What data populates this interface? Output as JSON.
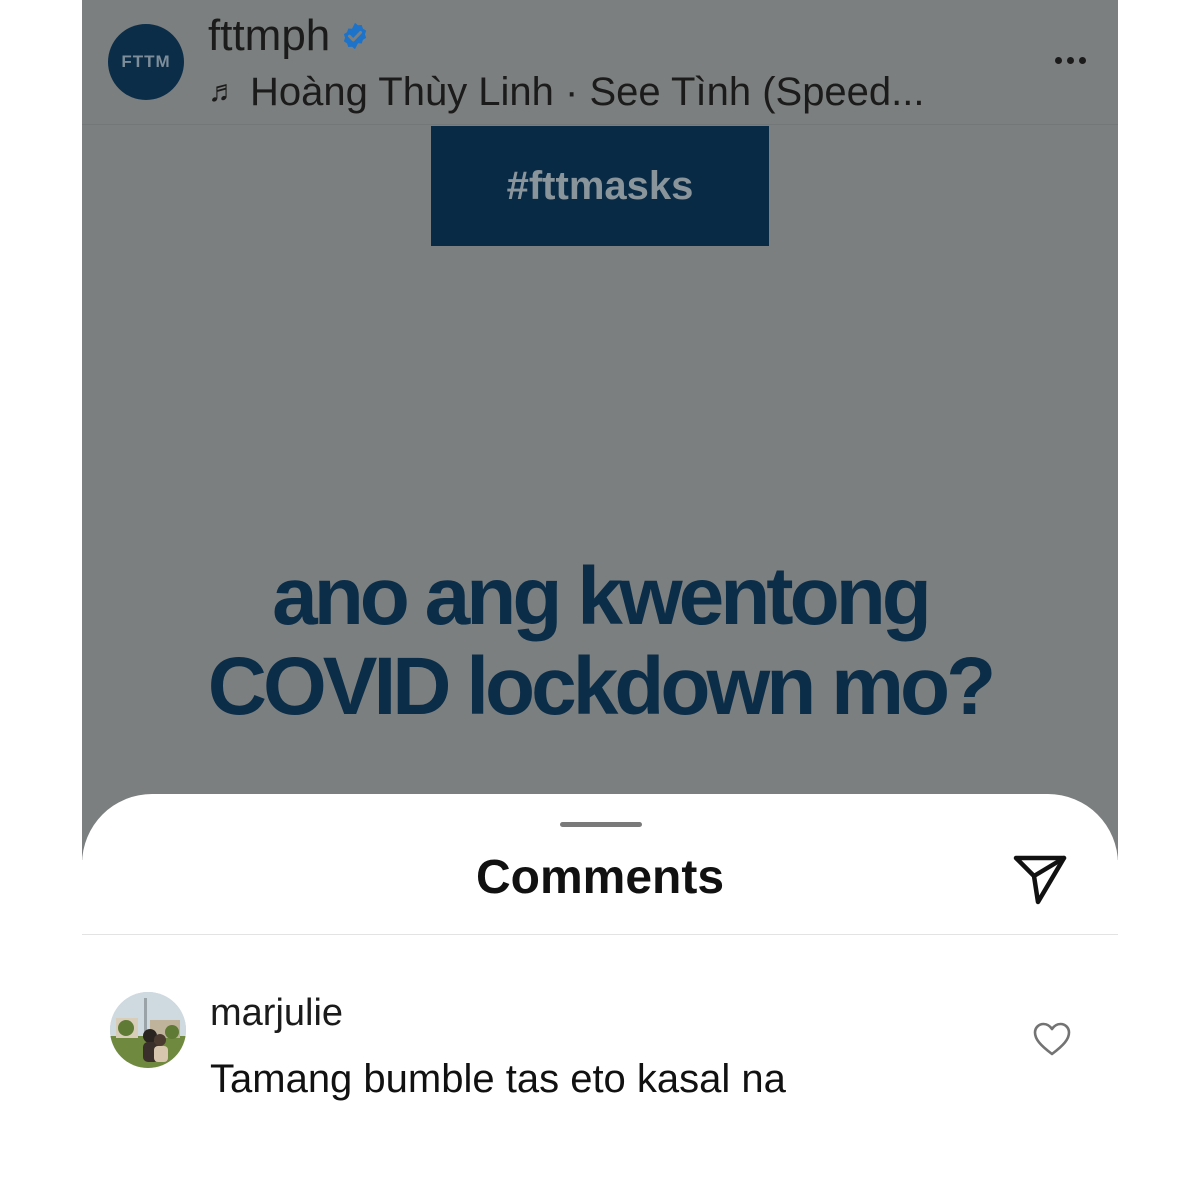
{
  "post": {
    "avatar_text": "FTTM",
    "username": "fttmph",
    "verified": true,
    "music": "Hoàng Thùy Linh · See Tình (Speed...",
    "more_icon": "more-horizontal-icon",
    "hashtag": "#fttmasks",
    "headline_line1": "ano ang kwentong",
    "headline_line2": "COVID lockdown mo?",
    "colors": {
      "overlay": "#7c7f7f",
      "brand_navy": "#0b2d48",
      "verified_blue": "#1d73c9"
    }
  },
  "comments_sheet": {
    "title": "Comments",
    "share_icon": "send-icon",
    "comments": [
      {
        "username": "marjulie",
        "text": "Tamang bumble tas eto kasal na",
        "like_icon": "heart-outline-icon"
      }
    ]
  }
}
